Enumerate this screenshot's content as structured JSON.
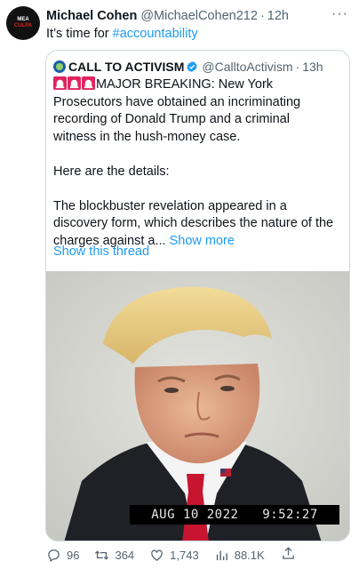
{
  "author": {
    "name": "Michael Cohen",
    "handle": "@MichaelCohen212",
    "time": "12h",
    "avatar_text_top": "MEA",
    "avatar_text_bottom": "CULPA",
    "more_icon": "more-icon"
  },
  "tweet": {
    "text_prefix": "It’s time for",
    "hashtag": "#accountability"
  },
  "quote": {
    "name": "CALL TO ACTIVISM",
    "handle": "@CalltoActivism",
    "time": "13h",
    "lines": [
      "MAJOR BREAKING: New York",
      "Prosecutors have obtained an incriminating",
      "recording of Donald Trump and a criminal",
      "witness in the hush-money case."
    ],
    "details_line": "Here are the details:",
    "body_lines": [
      "The blockbuster revelation appeared in a",
      "discovery form, which describes the nature of the"
    ],
    "last_line": "charges against a...",
    "show_more": "Show more",
    "show_thread": "Show this thread",
    "media": {
      "overlay_date": "AUG 10 2022",
      "overlay_time": "9:52:27"
    }
  },
  "actions": {
    "replies": "96",
    "retweets": "364",
    "likes": "1,743",
    "views": "88.1K"
  },
  "colors": {
    "accent": "#1d9bf0",
    "text": "#0f1419",
    "muted": "#536471",
    "border": "#cfd9de"
  }
}
